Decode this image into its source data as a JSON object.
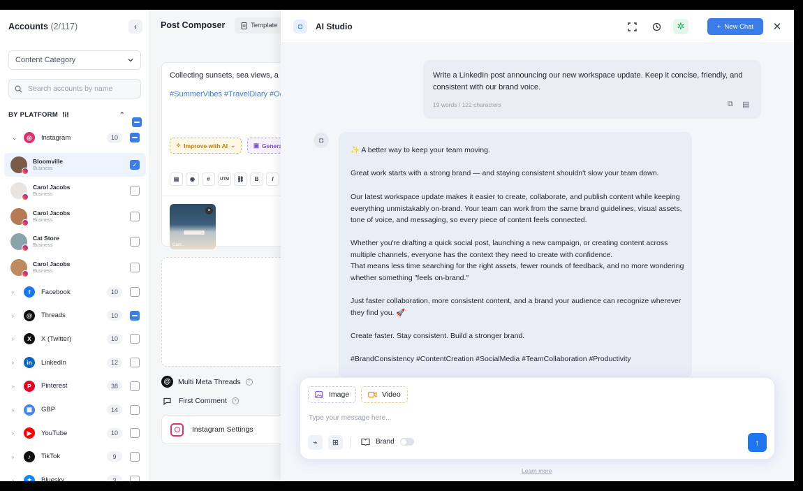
{
  "accounts": {
    "title": "Accounts",
    "count": "(2/117)",
    "collapse_glyph": "‹",
    "category_label": "Content Category",
    "search_placeholder": "Search accounts by name",
    "by_platform_label": "BY PLATFORM",
    "platforms": [
      {
        "name": "Instagram",
        "count": "10",
        "state": "partial",
        "color": "#e1306c",
        "glyph": "◎"
      },
      {
        "name": "Facebook",
        "count": "10",
        "state": "none",
        "color": "#1877f2",
        "glyph": "f"
      },
      {
        "name": "Threads",
        "count": "10",
        "state": "partial",
        "color": "#111111",
        "glyph": "@"
      },
      {
        "name": "X (Twitter)",
        "count": "10",
        "state": "none",
        "color": "#111111",
        "glyph": "X"
      },
      {
        "name": "LinkedIn",
        "count": "12",
        "state": "none",
        "color": "#0a66c2",
        "glyph": "in"
      },
      {
        "name": "Pinterest",
        "count": "38",
        "state": "none",
        "color": "#e60023",
        "glyph": "P"
      },
      {
        "name": "GBP",
        "count": "14",
        "state": "none",
        "color": "#4285f4",
        "glyph": "▦"
      },
      {
        "name": "YouTube",
        "count": "10",
        "state": "none",
        "color": "#ff0000",
        "glyph": "▶"
      },
      {
        "name": "TikTok",
        "count": "9",
        "state": "none",
        "color": "#111111",
        "glyph": "♪"
      },
      {
        "name": "Bluesky",
        "count": "3",
        "state": "none",
        "color": "#1185fe",
        "glyph": "✦"
      }
    ],
    "instagram_accounts": [
      {
        "name": "Bloomville",
        "type": "Business",
        "checked": true,
        "avatar": "#7a5b4a"
      },
      {
        "name": "Carol Jacobs",
        "type": "Business",
        "checked": false,
        "avatar": "#e9e4df"
      },
      {
        "name": "Carol Jacobs",
        "type": "Business",
        "checked": false,
        "avatar": "#b67a54"
      },
      {
        "name": "Cat Store",
        "type": "Business",
        "checked": false,
        "avatar": "#8aa3a8"
      },
      {
        "name": "Carol Jacobs",
        "type": "Business",
        "checked": false,
        "avatar": "#c08a5e"
      }
    ]
  },
  "composer": {
    "title": "Post Composer",
    "template_label": "Template",
    "text": "Collecting sunsets, sea views, a",
    "hashtags": "#SummerVibes #TravelDiary #Oce",
    "improve_label": "Improve with AI",
    "generate_label": "Genera",
    "toolbar": [
      "▤",
      "◉",
      "#",
      "UTM",
      "⛓",
      "B",
      "I"
    ],
    "thumb_label": "Cam...",
    "multi_threads_label": "Multi Meta Threads",
    "first_comment_label": "First Comment",
    "instagram_settings_label": "Instagram Settings"
  },
  "ai_studio": {
    "title": "AI Studio",
    "new_chat_label": "New Chat",
    "user_message": "Write a LinkedIn post announcing our new workspace update. Keep it concise, friendly, and consistent with our brand voice.",
    "user_meta": "19 words / 122 characters",
    "bot_paragraphs": [
      "✨ A better way to keep your team moving.",
      "Great work starts with a strong brand — and staying consistent shouldn't slow your team down.",
      "Our latest workspace update makes it easier to create, collaborate, and publish content while keeping everything unmistakably on-brand. Your team can work from the same brand guidelines, visual assets, tone of voice, and messaging, so every piece of content feels connected.",
      "Whether you're drafting a quick social post, launching a new campaign, or creating content across multiple channels, everyone has the context they need to create with confidence.",
      "That means less time searching for the right assets, fewer rounds of feedback, and no more wondering whether something \"feels on-brand.\"",
      "Just faster collaboration, more consistent content, and a brand your audience can recognize wherever they find you. 🚀",
      "Create faster. Stay consistent. Build a stronger brand.",
      "#BrandConsistency #ContentCreation #SocialMedia #TeamCollaboration #Productivity"
    ],
    "image_label": "Image",
    "video_label": "Video",
    "input_placeholder": "Type your message here...",
    "brand_label": "Brand",
    "learn_more": "Learn more"
  },
  "colors": {
    "accent": "#3a7ce8",
    "send": "#1f74f0"
  }
}
